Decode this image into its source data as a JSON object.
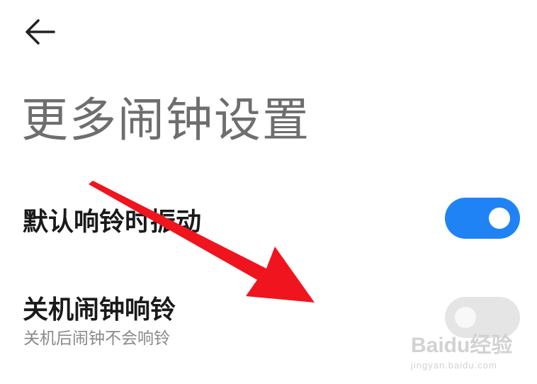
{
  "header": {
    "back_icon": "arrow-left-icon"
  },
  "page": {
    "title": "更多闹钟设置"
  },
  "settings": [
    {
      "label": "默认响铃时振动",
      "subtitle": "",
      "toggle_on": true
    },
    {
      "label": "关机闹钟响铃",
      "subtitle": "关机后闹钟不会响铃",
      "toggle_on": false
    }
  ],
  "colors": {
    "toggle_on": "#1f83f5",
    "toggle_off": "#e5e5e5",
    "annotation_arrow": "#f0141e"
  },
  "watermark": {
    "brand": "Baidu经验",
    "url": "jingyan.baidu.com"
  }
}
